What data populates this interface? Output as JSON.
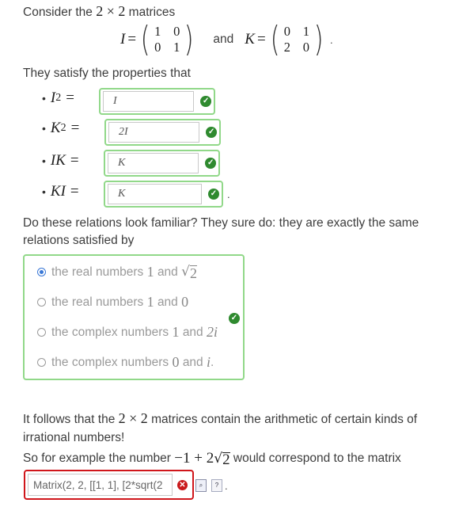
{
  "intro": {
    "text1": "Consider the",
    "dims": "2 × 2",
    "text2": "matrices"
  },
  "matrix_I": {
    "name": "I",
    "entries": [
      "1",
      "0",
      "0",
      "1"
    ]
  },
  "matrix_K": {
    "name": "K",
    "entries": [
      "0",
      "1",
      "2",
      "0"
    ]
  },
  "and_text": "and",
  "eq": "=",
  "period": ".",
  "properties_text": "They satisfy the properties that",
  "properties": [
    {
      "lhs_base": "I",
      "lhs_sup": "2",
      "answer": "I"
    },
    {
      "lhs_base": "K",
      "lhs_sup": "2",
      "answer": "2I"
    },
    {
      "lhs_base": "IK",
      "lhs_sup": "",
      "answer": "K"
    },
    {
      "lhs_base": "KI",
      "lhs_sup": "",
      "answer": "K"
    }
  ],
  "familiar_text": "Do these relations look familiar? They sure do: they are exactly the same relations satisfied by",
  "choices": [
    {
      "prefix": "the real numbers",
      "a": "1",
      "and": "and",
      "b": "√2",
      "selected": true
    },
    {
      "prefix": "the real numbers",
      "a": "1",
      "and": "and",
      "b": "0",
      "selected": false
    },
    {
      "prefix": "the complex numbers",
      "a": "1",
      "and": "and",
      "b": "2i",
      "selected": false
    },
    {
      "prefix": "the complex numbers",
      "a": "0",
      "and": "and",
      "b": "i",
      "selected": false
    }
  ],
  "follows": {
    "text1": "It follows that the",
    "dims": "2 × 2",
    "text2": "matrices contain the arithmetic of certain kinds of irrational numbers!"
  },
  "example": {
    "text1": "So for example the number",
    "expr_a": "−1 + 2",
    "radicand": "2",
    "text2": "would correspond to the matrix"
  },
  "matrix_input": {
    "value": "Matrix(2, 2, [[1, 1], [2*sqrt(2"
  },
  "icons": {
    "correct": "check-icon",
    "incorrect": "x-icon"
  },
  "colors": {
    "correct_border": "#91d889",
    "correct_icon": "#2f8a2f",
    "incorrect_border": "#d0161b",
    "selected_radio": "#3a78d6"
  }
}
